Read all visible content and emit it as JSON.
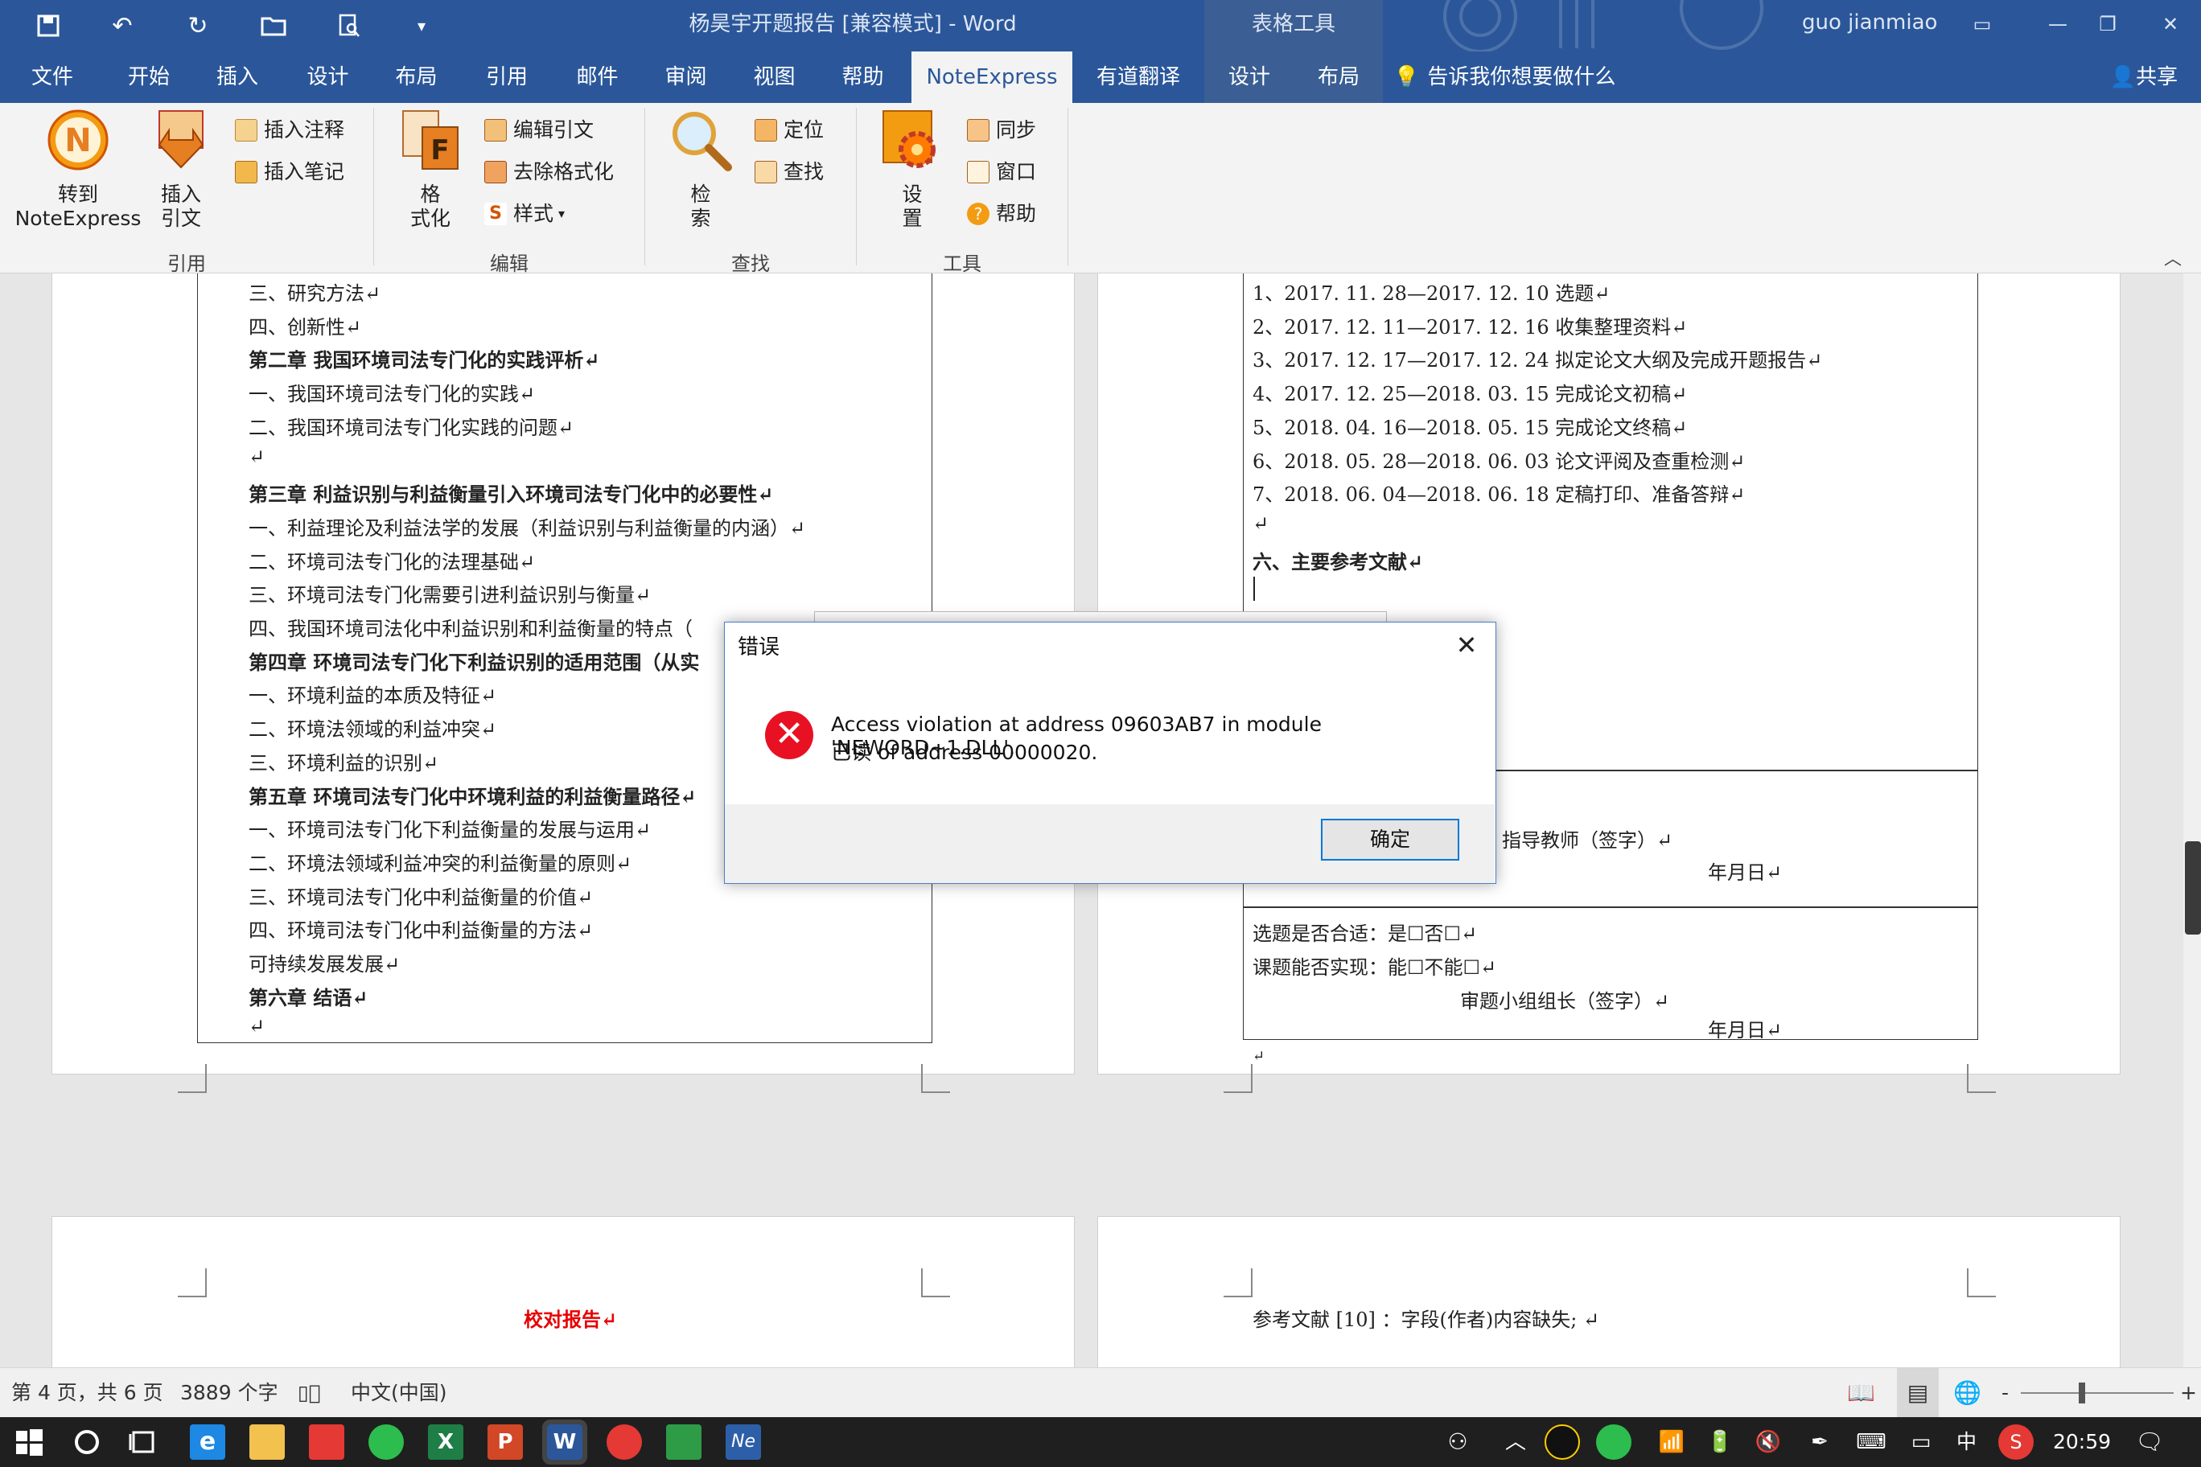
{
  "titlebar": {
    "document_title": "杨昊宇开题报告 [兼容模式]  -  Word",
    "context_tools": "表格工具",
    "user": "guo jianmiao"
  },
  "tabs": [
    "文件",
    "开始",
    "插入",
    "设计",
    "布局",
    "引用",
    "邮件",
    "审阅",
    "视图",
    "帮助",
    "NoteExpress",
    "有道翻译",
    "设计",
    "布局"
  ],
  "tell_me": "告诉我你想要做什么",
  "share": "共享",
  "ribbon": {
    "groups": [
      "引用",
      "编辑",
      "查找",
      "工具"
    ],
    "goto_ne": "转到",
    "goto_ne2": "NoteExpress",
    "insert_cite": "插入",
    "insert_cite2": "引文",
    "insert_note": "插入注释",
    "insert_memo": "插入笔记",
    "format": "格",
    "format2": "式化",
    "edit_cite": "编辑引文",
    "remove_format": "去除格式化",
    "style": "样式",
    "search": "检",
    "search2": "索",
    "locate": "定位",
    "find": "查找",
    "settings": "设",
    "settings2": "置",
    "sync": "同步",
    "window": "窗口",
    "help": "帮助"
  },
  "page_left": [
    {
      "t": "三、研究方法↵",
      "b": false
    },
    {
      "t": "四、创新性↵",
      "b": false
    },
    {
      "t": "第二章  我国环境司法专门化的实践评析↵",
      "b": true
    },
    {
      "t": "一、我国环境司法专门化的实践↵",
      "b": false
    },
    {
      "t": "二、我国环境司法专门化实践的问题↵",
      "b": false
    },
    {
      "t": "↵",
      "b": false
    },
    {
      "t": "第三章  利益识别与利益衡量引入环境司法专门化中的必要性↵",
      "b": true
    },
    {
      "t": "一、利益理论及利益法学的发展（利益识别与利益衡量的内涵）↵",
      "b": false
    },
    {
      "t": "二、环境司法专门化的法理基础↵",
      "b": false
    },
    {
      "t": "三、环境司法专门化需要引进利益识别与衡量↵",
      "b": false
    },
    {
      "t": "四、我国环境司法化中利益识别和利益衡量的特点（",
      "b": false
    },
    {
      "t": "第四章  环境司法专门化下利益识别的适用范围（从实",
      "b": true
    },
    {
      "t": "一、环境利益的本质及特征↵",
      "b": false
    },
    {
      "t": "二、环境法领域的利益冲突↵",
      "b": false
    },
    {
      "t": "三、环境利益的识别↵",
      "b": false
    },
    {
      "t": "第五章  环境司法专门化中环境利益的利益衡量路径↵",
      "b": true
    },
    {
      "t": "一、环境司法专门化下利益衡量的发展与运用↵",
      "b": false
    },
    {
      "t": "二、环境法领域利益冲突的利益衡量的原则↵",
      "b": false
    },
    {
      "t": "三、环境司法专门化中利益衡量的价值↵",
      "b": false
    },
    {
      "t": "四、环境司法专门化中利益衡量的方法↵",
      "b": false
    },
    {
      "t": "可持续发展发展↵",
      "b": false
    },
    {
      "t": "第六章  结语↵",
      "b": true
    },
    {
      "t": "↵",
      "b": false
    }
  ],
  "page_right": [
    {
      "t": "1、2017. 11. 28—2017. 12. 10 选题↵",
      "b": false
    },
    {
      "t": "2、2017. 12. 11—2017. 12. 16 收集整理资料↵",
      "b": false
    },
    {
      "t": "3、2017. 12. 17—2017. 12. 24 拟定论文大纲及完成开题报告↵",
      "b": false
    },
    {
      "t": "4、2017. 12. 25—2018. 03. 15 完成论文初稿↵",
      "b": false
    },
    {
      "t": "5、2018. 04. 16—2018. 05. 15 完成论文终稿↵",
      "b": false
    },
    {
      "t": "6、2018. 05. 28—2018. 06. 03 论文评阅及查重检测↵",
      "b": false
    },
    {
      "t": "7、2018. 06. 04—2018. 06. 18 定稿打印、准备答辩↵",
      "b": false
    },
    {
      "t": "↵",
      "b": false
    },
    {
      "t": "六、主要参考文献↵",
      "b": true
    }
  ],
  "right_table": {
    "advisor_sign": "指导教师（签字）↵",
    "date1": "年月日↵",
    "q1": "选题是否合适：是☐否☐↵",
    "q2": "课题能否实现：能☐不能☐↵",
    "leader_sign": "审题小组组长（签字）↵",
    "date2": "年月日↵",
    "return_mark": "↵"
  },
  "page3_text": "校对报告↵",
  "page4_text": "参考文献 [10] ：字段(作者)内容缺失; ↵",
  "dialog": {
    "title": "错误",
    "line1": "Access violation at address 09603AB7 in module 'NEWORD~1.DLL'.",
    "line2": "已读 of address 00000020.",
    "ok": "确定"
  },
  "status": {
    "page": "第 4 页，共 6 页",
    "words": "3889 个字",
    "lang": "中文(中国)",
    "zoom_minus": "-",
    "zoom_plus": "+"
  },
  "taskbar": {
    "ime": "中",
    "time": "20:59"
  },
  "colors": {
    "word_blue": "#2b579a",
    "error_red": "#e81123",
    "ne_orange": "#f39c12"
  }
}
